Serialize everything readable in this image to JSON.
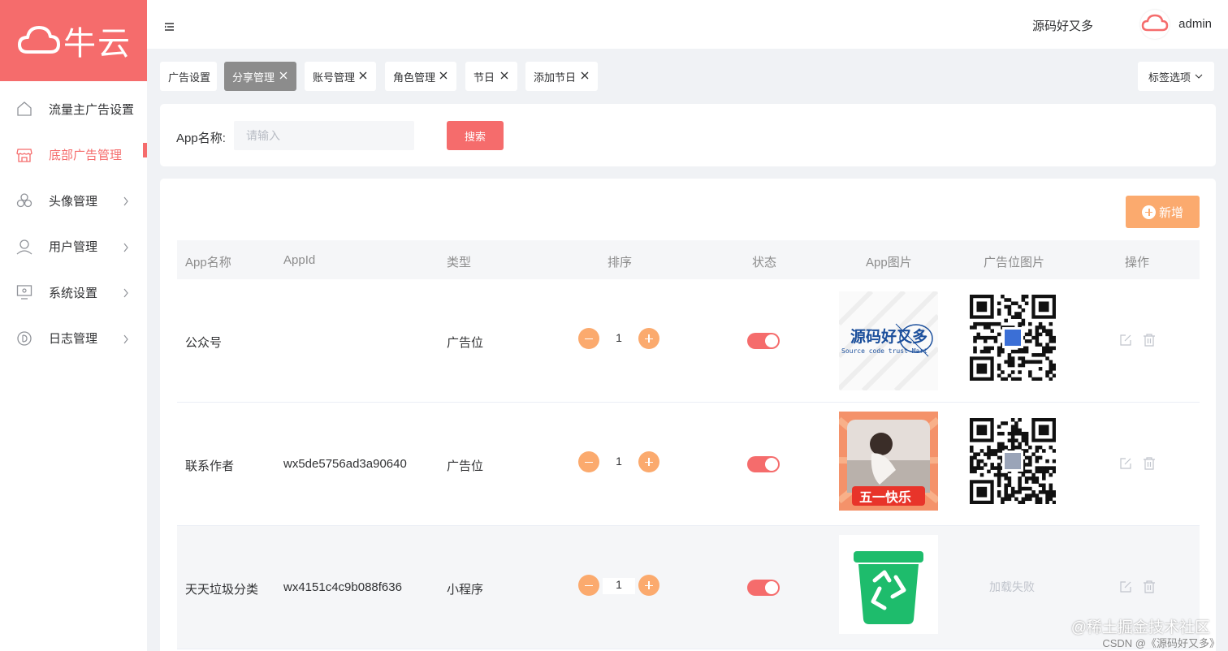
{
  "brand": {
    "name": "牛云",
    "color": "#f56c6c"
  },
  "sidebar": {
    "items": [
      {
        "label": "流量主广告设置",
        "icon": "home-icon",
        "active": false,
        "has_children": false
      },
      {
        "label": "底部广告管理",
        "icon": "store-icon",
        "active": true,
        "has_children": false
      },
      {
        "label": "头像管理",
        "icon": "circles-icon",
        "active": false,
        "has_children": true
      },
      {
        "label": "用户管理",
        "icon": "user-icon",
        "active": false,
        "has_children": true
      },
      {
        "label": "系统设置",
        "icon": "monitor-icon",
        "active": false,
        "has_children": true
      },
      {
        "label": "日志管理",
        "icon": "d-circle-icon",
        "active": false,
        "has_children": true
      }
    ]
  },
  "header": {
    "link": "源码好又多",
    "user": "admin"
  },
  "tags": {
    "items": [
      {
        "label": "广告设置",
        "closable": false,
        "active": false
      },
      {
        "label": "分享管理",
        "closable": true,
        "active": true
      },
      {
        "label": "账号管理",
        "closable": true,
        "active": false
      },
      {
        "label": "角色管理",
        "closable": true,
        "active": false
      },
      {
        "label": "节日",
        "closable": true,
        "active": false
      },
      {
        "label": "添加节日",
        "closable": true,
        "active": false
      }
    ],
    "options_label": "标签选项"
  },
  "search": {
    "label": "App名称:",
    "placeholder": "请输入",
    "button": "搜索"
  },
  "table": {
    "add_label": "新增",
    "columns": [
      "App名称",
      "AppId",
      "类型",
      "排序",
      "状态",
      "App图片",
      "广告位图片",
      "操作"
    ],
    "rows": [
      {
        "name": "公众号",
        "appid": "",
        "type": "广告位",
        "sort": "1",
        "status": true,
        "app_img": "logo",
        "ad_img": "qr"
      },
      {
        "name": "联系作者",
        "appid": "wx5de5756ad3a90640",
        "type": "广告位",
        "sort": "1",
        "status": true,
        "app_img": "photo",
        "ad_img": "qr"
      },
      {
        "name": "天天垃圾分类",
        "appid": "wx4151c4c9b088f636",
        "type": "小程序",
        "sort": "1",
        "status": true,
        "app_img": "trash",
        "ad_img": "failed"
      }
    ],
    "app_logo_text": "源码好又多",
    "app_logo_sub": "Source code trust Mart",
    "photo_caption": "五一快乐",
    "ad_failed_text": "加载失败"
  },
  "watermark": {
    "line1": "@稀土掘金技术社区",
    "line2": "CSDN @《源码好又多》"
  }
}
